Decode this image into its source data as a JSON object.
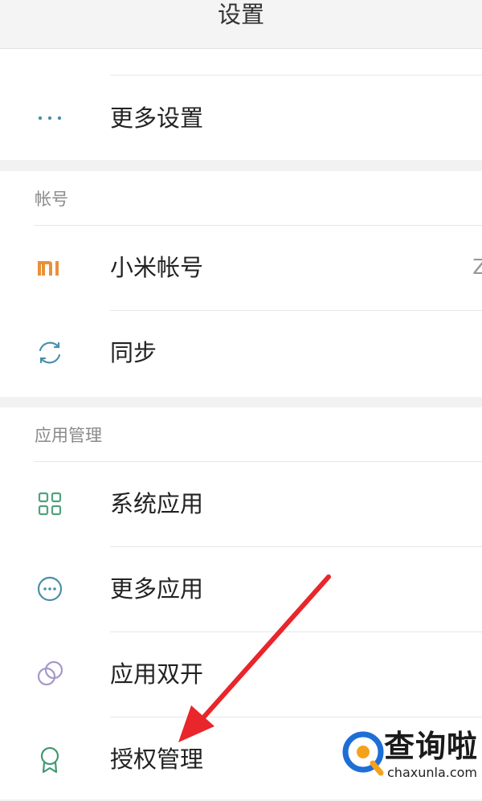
{
  "header": {
    "title": "设置"
  },
  "top_section": {
    "more_settings": {
      "label": "更多设置",
      "icon": "more-dots-icon"
    }
  },
  "account_section": {
    "title": "帐号",
    "items": [
      {
        "label": "小米帐号",
        "icon": "mi-logo-icon",
        "edge_text": "Z"
      },
      {
        "label": "同步",
        "icon": "sync-icon"
      }
    ]
  },
  "apps_section": {
    "title": "应用管理",
    "items": [
      {
        "label": "系统应用",
        "icon": "grid-icon"
      },
      {
        "label": "更多应用",
        "icon": "more-circle-icon"
      },
      {
        "label": "应用双开",
        "icon": "dual-circles-icon"
      },
      {
        "label": "授权管理",
        "icon": "badge-icon"
      }
    ]
  },
  "annotation": {
    "arrow_color": "#e8262b"
  },
  "watermark": {
    "title": "查询啦",
    "domain": "chaxunla.com"
  },
  "colors": {
    "icon_teal": "#4a90a8",
    "mi_orange": "#e8913a",
    "grid_green": "#4fa37e",
    "purple": "#a698c9",
    "badge_green": "#3f9b70"
  }
}
